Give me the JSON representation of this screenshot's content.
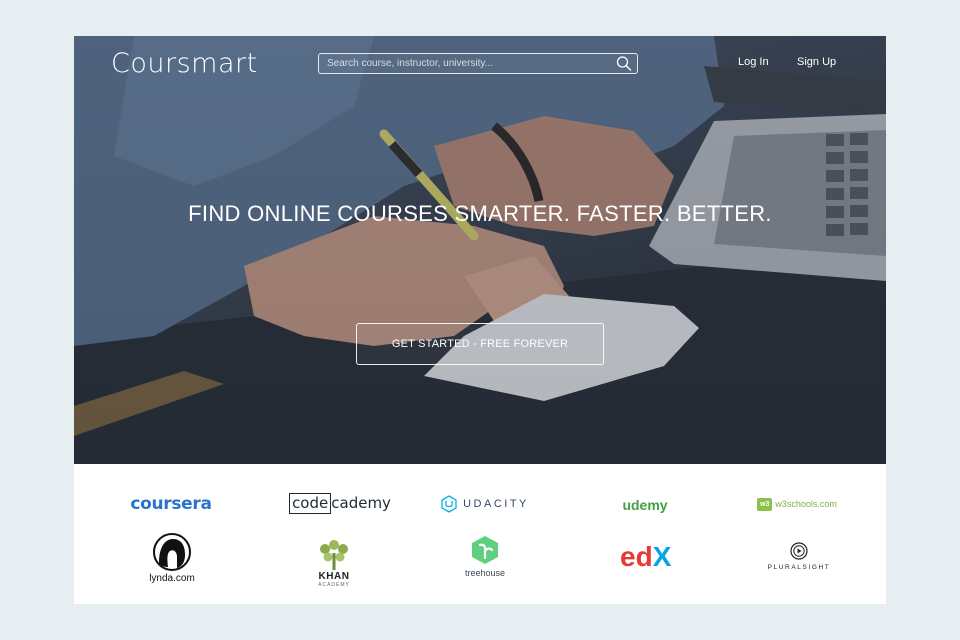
{
  "header": {
    "logo": "Coursmart",
    "search": {
      "placeholder": "Search course, instructor, university..."
    },
    "nav": {
      "login": "Log In",
      "signup": "Sign Up"
    }
  },
  "hero": {
    "headline": "FIND ONLINE COURSES SMARTER. FASTER. BETTER.",
    "cta_label": "GET STARTED - FREE FOREVER"
  },
  "partners": {
    "coursera": "coursera",
    "codecademy_box": "code",
    "codecademy_rest": "cademy",
    "udacity": "UDACITY",
    "udemy": "udemy",
    "w3schools_badge": "w3",
    "w3schools": "w3schools.com",
    "lynda": "lynda.com",
    "khan": "KHAN",
    "khan_sub": "ACADEMY",
    "treehouse": "treehouse",
    "edx": "edX",
    "pluralsight": "PLURALSIGHT"
  },
  "colors": {
    "page_bg": "#e6eef1",
    "coursera": "#2a73cc",
    "udemy": "#43a047",
    "w3schools": "#8bc34a",
    "treehouse": "#5fcf80",
    "edx_red": "#e53935",
    "edx_blue": "#02a6e0",
    "khan": "#9cb85c"
  },
  "icons": {
    "search": "search-icon",
    "udacity": "udacity-logo-icon",
    "lynda": "lynda-face-icon",
    "khan": "khan-tree-icon",
    "treehouse": "treehouse-leaf-icon",
    "pluralsight": "pluralsight-play-icon"
  }
}
